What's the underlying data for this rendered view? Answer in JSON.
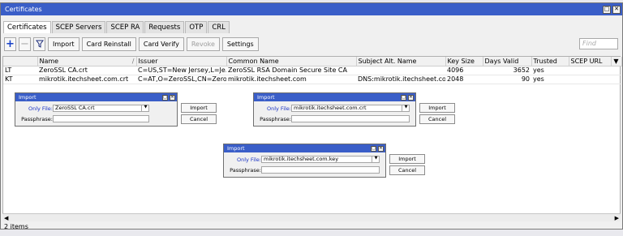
{
  "window": {
    "title": "Certificates"
  },
  "tabs": [
    "Certificates",
    "SCEP Servers",
    "SCEP RA",
    "Requests",
    "OTP",
    "CRL"
  ],
  "toolbar": {
    "import": "Import",
    "card_reinstall": "Card Reinstall",
    "card_verify": "Card Verify",
    "revoke": "Revoke",
    "settings": "Settings",
    "find_placeholder": "Find"
  },
  "table": {
    "columns": [
      "",
      "Name",
      "Issuer",
      "Common Name",
      "Subject Alt. Name",
      "Key Size",
      "Days Valid",
      "Trusted",
      "SCEP URL"
    ],
    "rows": [
      {
        "flags": "LT",
        "name": "ZeroSSL CA.crt",
        "issuer": "C=US,ST=New Jersey,L=Je...",
        "common_name": "ZeroSSL RSA Domain Secure Site CA",
        "san": "",
        "key_size": "4096",
        "days_valid": "3652",
        "trusted": "yes",
        "scep_url": ""
      },
      {
        "flags": "KT",
        "name": "mikrotik.itechsheet.com.crt",
        "issuer": "C=AT,O=ZeroSSL,CN=Zero...",
        "common_name": "mikrotik.itechsheet.com",
        "san": "DNS:mikrotik.itechsheet.com",
        "key_size": "2048",
        "days_valid": "90",
        "trusted": "yes",
        "scep_url": ""
      }
    ]
  },
  "status": {
    "items": "2 items"
  },
  "dialogs": [
    {
      "title": "Import",
      "only_file_label": "Only File:",
      "only_file_value": "ZeroSSL CA.crt",
      "passphrase_label": "Passphrase:",
      "passphrase_value": "",
      "import_label": "Import",
      "cancel_label": "Cancel"
    },
    {
      "title": "Import",
      "only_file_label": "Only File:",
      "only_file_value": "mikrotik.itechsheet.com.crt",
      "passphrase_label": "Passphrase:",
      "passphrase_value": "",
      "import_label": "Import",
      "cancel_label": "Cancel"
    },
    {
      "title": "Import",
      "only_file_label": "Only File:",
      "only_file_value": "mikrotik.itechsheet.com.key",
      "passphrase_label": "Passphrase:",
      "passphrase_value": "",
      "import_label": "Import",
      "cancel_label": "Cancel"
    }
  ],
  "colors": {
    "titlebar": "#3a5ec8",
    "label_blue": "#1a33c4"
  }
}
